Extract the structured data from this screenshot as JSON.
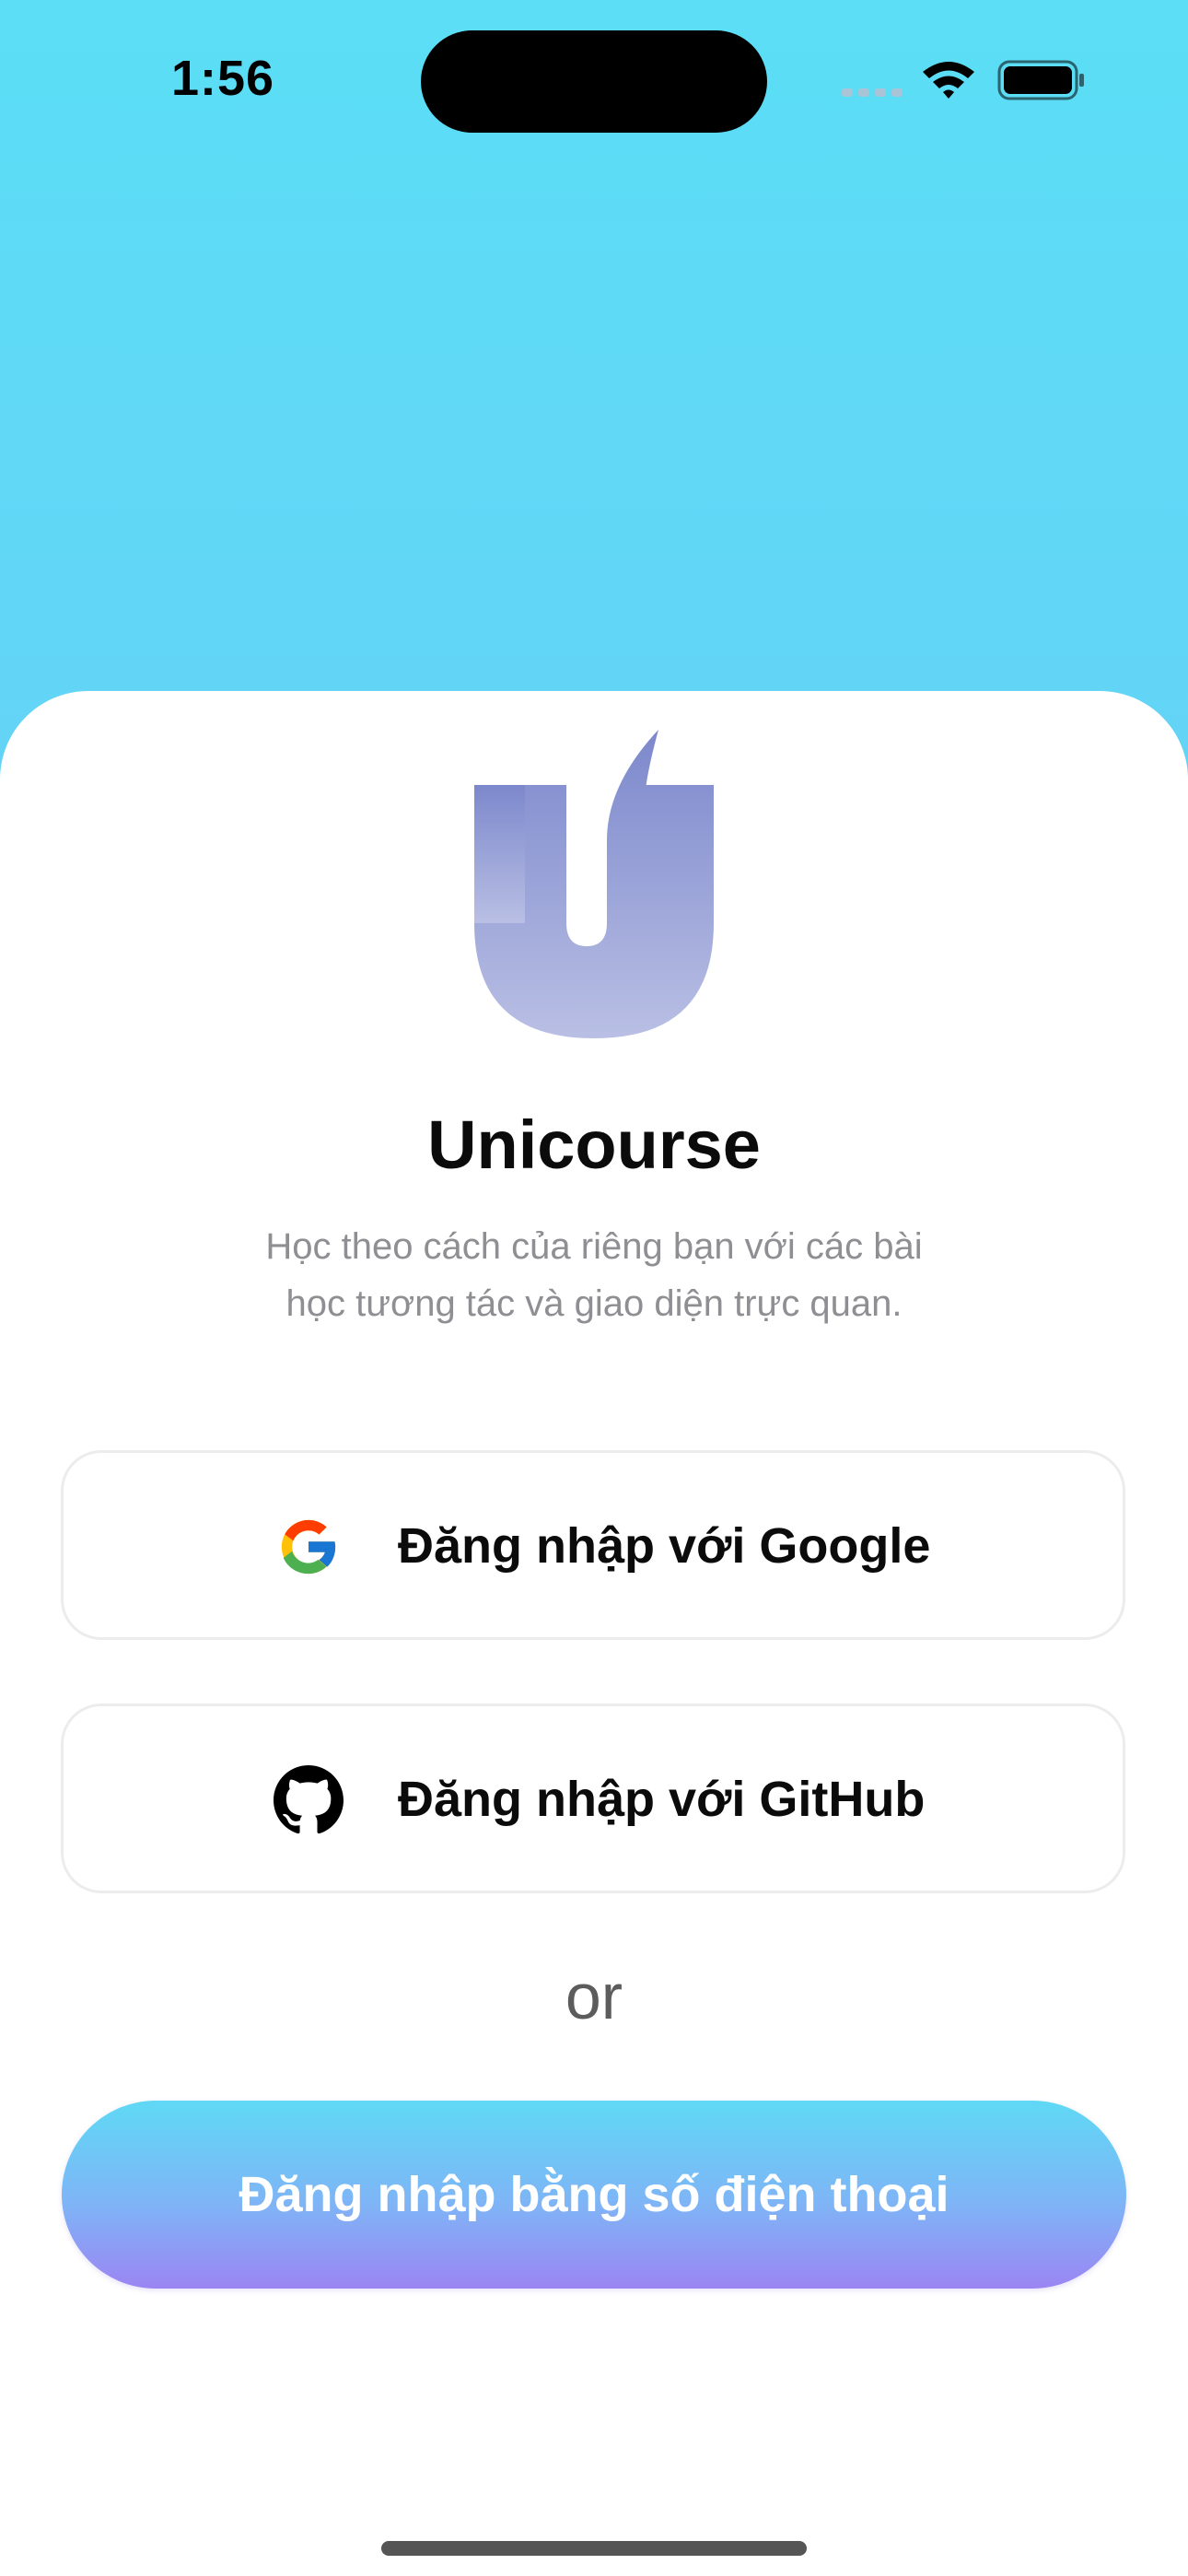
{
  "status_bar": {
    "time": "1:56"
  },
  "app": {
    "name": "Unicourse",
    "subtitle_line1": "Học theo cách của riêng bạn với các bài",
    "subtitle_line2": "học tương tác và giao diện trực quan."
  },
  "buttons": {
    "google_label": "Đăng nhập với Google",
    "github_label": "Đăng nhập với GitHub",
    "phone_label": "Đăng nhập bằng số điện thoại"
  },
  "divider_text": "or",
  "icons": {
    "logo": "unicourse-logo",
    "google": "google-icon",
    "github": "github-icon",
    "wifi": "wifi-icon",
    "battery": "battery-icon",
    "signal": "signal-icon"
  },
  "colors": {
    "background_top": "#5bdef6",
    "background_bottom": "#72bdf4",
    "phone_button_top": "#5fd9f5",
    "phone_button_bottom": "#9b85f3",
    "logo": "#8b93d3"
  }
}
